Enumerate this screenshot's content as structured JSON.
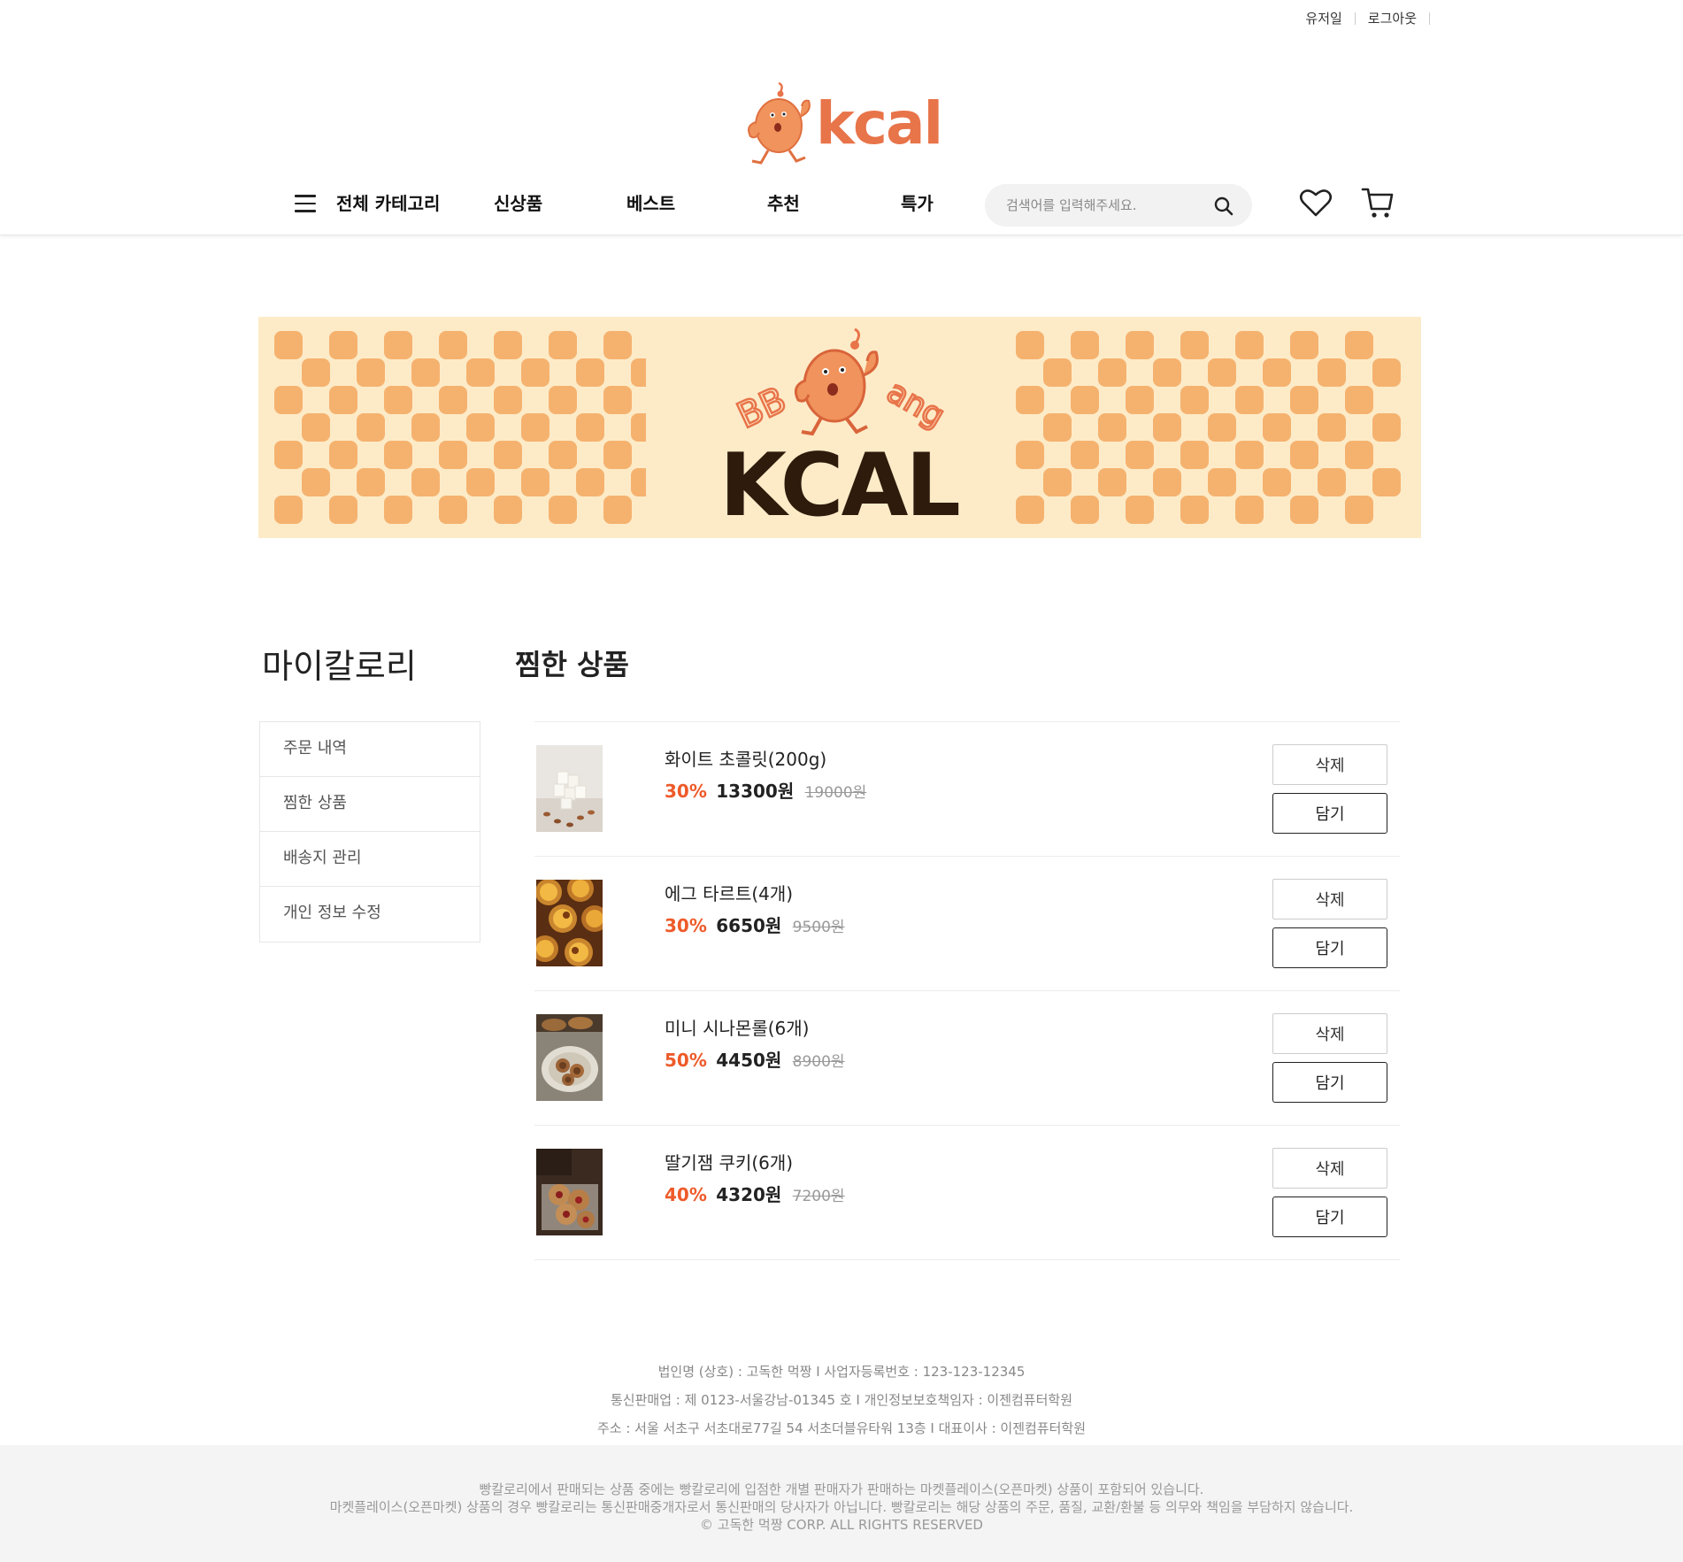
{
  "header": {
    "user_link": "유저일",
    "logout_link": "로그아웃",
    "logo_text": "kcal"
  },
  "nav": {
    "all_categories": "전체 카테고리",
    "items": [
      "신상품",
      "베스트",
      "추천",
      "특가"
    ],
    "search_placeholder": "검색어를 입력해주세요."
  },
  "banner": {
    "arc_left": "BB",
    "arc_right": "ang",
    "big_word": "KCAL",
    "bg_color": "#fdebc8",
    "check_color": "#f5b26f",
    "word_color": "#2e1b0c"
  },
  "sidebar": {
    "title": "마이칼로리",
    "items": [
      "주문 내역",
      "찜한 상품",
      "배송지 관리",
      "개인 정보 수정"
    ]
  },
  "main": {
    "title": "찜한 상품",
    "delete_label": "삭제",
    "add_label": "담기",
    "products": [
      {
        "name": "화이트 초콜릿(200g)",
        "rate": "30%",
        "sale": "13300원",
        "orig": "19000원",
        "thumb": "white-chocolate"
      },
      {
        "name": "에그 타르트(4개)",
        "rate": "30%",
        "sale": "6650원",
        "orig": "9500원",
        "thumb": "egg-tart"
      },
      {
        "name": "미니 시나몬롤(6개)",
        "rate": "50%",
        "sale": "4450원",
        "orig": "8900원",
        "thumb": "cinnamon-roll"
      },
      {
        "name": "딸기잼 쿠키(6개)",
        "rate": "40%",
        "sale": "4320원",
        "orig": "7200원",
        "thumb": "jam-cookie"
      }
    ]
  },
  "footer": {
    "line1": "법인명 (상호) : 고독한 먹짱 I 사업자등록번호 : 123-123-12345",
    "line2": "통신판매업 : 제 0123-서울강남-01345 호 I 개인정보보호책임자 : 이젠컴퓨터학원",
    "line3": "주소 : 서울 서초구 서초대로77길 54 서초더블유타워 13층 I 대표이사 : 이젠컴퓨터학원",
    "notice1": "빵칼로리에서 판매되는 상품 중에는 빵칼로리에 입점한 개별 판매자가 판매하는 마켓플레이스(오픈마켓) 상품이 포함되어 있습니다.",
    "notice2": "마켓플레이스(오픈마켓) 상품의 경우 빵칼로리는 통신판매중개자로서 통신판매의 당사자가 아닙니다. 빵칼로리는 해당 상품의 주문, 품질, 교환/환불 등 의무와 책임을 부담하지 않습니다.",
    "copyright": "© 고독한 먹짱 CORP. ALL RIGHTS RESERVED"
  },
  "colors": {
    "accent": "#ee5a2a",
    "logo": "#e8744a"
  }
}
